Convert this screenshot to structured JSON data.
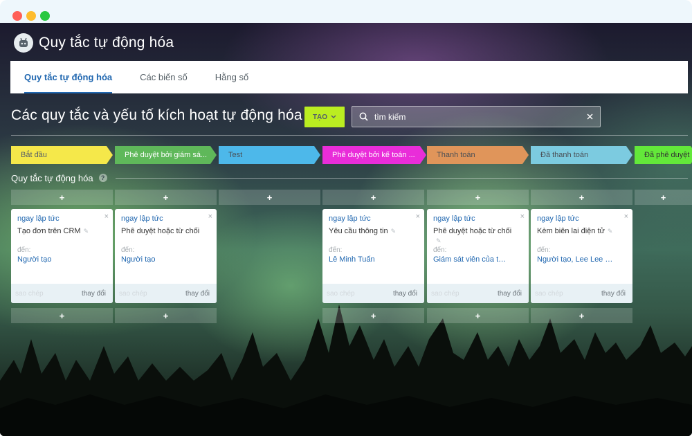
{
  "window": {
    "controls": [
      "close",
      "minimize",
      "maximize"
    ]
  },
  "app": {
    "title": "Quy tắc tự động hóa",
    "icon": "robot-icon"
  },
  "tabs": [
    {
      "label": "Quy tắc tự động hóa",
      "active": true
    },
    {
      "label": "Các biến số",
      "active": false
    },
    {
      "label": "Hằng số",
      "active": false
    }
  ],
  "toolbar": {
    "page_title": "Các quy tắc và yếu tố kích hoạt tự động hóa",
    "create_label": "TẠO",
    "search_placeholder": "tìm kiếm"
  },
  "stages": [
    {
      "label": "Bắt đầu",
      "color": "#f5e84a",
      "text_color": "#535c69"
    },
    {
      "label": "Phê duyệt bởi giám sá...",
      "color": "#5fb85a",
      "text_color": "#ffffff"
    },
    {
      "label": "Test",
      "color": "#4db8ea",
      "text_color": "#4a4f55"
    },
    {
      "label": "Phê duyệt bởi kế toán ...",
      "color": "#e92dd9",
      "text_color": "#ffffff"
    },
    {
      "label": "Thanh toán",
      "color": "#e0955a",
      "text_color": "#4a4f55"
    },
    {
      "label": "Đã thanh toán",
      "color": "#7ccbe0",
      "text_color": "#4a4f55"
    },
    {
      "label": "Đã phê duyệt",
      "color": "#63e83a",
      "text_color": "#333333"
    }
  ],
  "section": {
    "label": "Quy tắc tự động hóa",
    "help": "?"
  },
  "add_symbol": "+",
  "cards": [
    {
      "column": 0,
      "when": "ngay lập tức",
      "action": "Tạo đơn trên CRM",
      "to_label": "đến:",
      "to": "Người tạo",
      "copy": "sao chép",
      "edit": "thay đổi",
      "close": "×"
    },
    {
      "column": 1,
      "when": "ngay lập tức",
      "action": "Phê duyệt hoặc từ chối",
      "to_label": "đến:",
      "to": "Người tạo",
      "copy": "sao chép",
      "edit": "thay đổi",
      "close": "×"
    },
    {
      "column": 3,
      "when": "ngay lập tức",
      "action": "Yêu cầu thông tin",
      "to_label": "đến:",
      "to": "Lê Minh Tuấn",
      "copy": "sao chép",
      "edit": "thay đổi",
      "close": "×"
    },
    {
      "column": 4,
      "when": "ngay lập tức",
      "action": "Phê duyệt hoặc từ chối",
      "to_label": "đến:",
      "to": "Giám sát viên của t…",
      "copy": "sao chép",
      "edit": "thay đổi",
      "close": "×"
    },
    {
      "column": 5,
      "when": "ngay lập tức",
      "action": "Kèm biên lai điện tử",
      "to_label": "đến:",
      "to": "Người tạo, Lee Lee …",
      "copy": "sao chép",
      "edit": "thay đổi",
      "close": "×"
    }
  ]
}
